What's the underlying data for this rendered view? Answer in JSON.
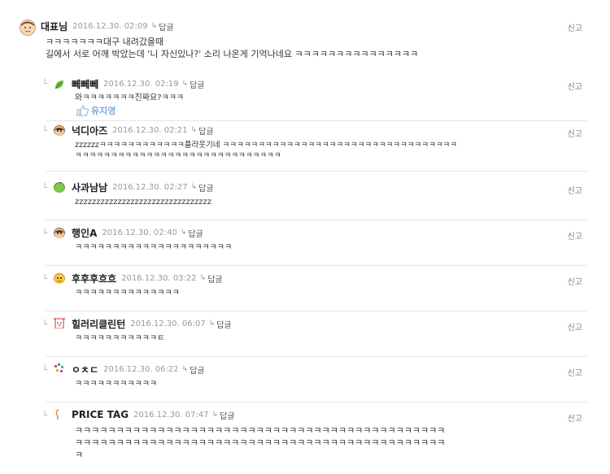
{
  "report_label": "신고",
  "reply_label": "답글",
  "comments": [
    {
      "name": "대표님",
      "date": "2016.12.30. 02:09",
      "lines": [
        "ㅋㅋㅋㅋㅋㅋㅋ대구 내려갔을때",
        "길에서 서로 어깨 박았는데 '니 자신있나?' 소리 나온게 기억나네요 ㅋㅋㅋㅋㅋㅋㅋㅋㅋㅋㅋㅋㅋㅋㅋ"
      ]
    },
    {
      "name": "뻬뻬뻬",
      "date": "2016.12.30. 02:19",
      "lines": [
        "와ㅋㅋㅋㅋㅋㅋㅋ진짜요?ㅋㅋㅋ"
      ],
      "like_name": "유지영"
    },
    {
      "name": "넉디아즈",
      "date": "2016.12.30. 02:21",
      "lines": [
        "zzzzzzㅋㅋㅋㅋㅋㅋㅋㅋㅋㅋㅋㅋ플라웃기네 ㅋㅋㅋㅋㅋㅋㅋㅋㅋㅋㅋㅋㅋㅋㅋㅋㅋㅋㅋㅋㅋㅋㅋㅋㅋㅋㅋㅋㅋㅋㅋㅋㅋ",
        "ㅋㅋㅋㅋㅋㅋㅋㅋㅋㅋㅋㅋㅋㅋㅋㅋㅋㅋㅋㅋㅋㅋㅋㅋㅋㅋㅋㅋㅋ"
      ]
    },
    {
      "name": "사과남남",
      "date": "2016.12.30. 02:27",
      "lines": [
        "zzzzzzzzzzzzzzzzzzzzzzzzzzzzzzzz"
      ]
    },
    {
      "name": "행인A",
      "date": "2016.12.30. 02:40",
      "lines": [
        "ㅋㅋㅋㅋㅋㅋㅋㅋㅋㅋㅋㅋㅋㅋㅋㅋㅋㅋㅋㅋㅋ"
      ]
    },
    {
      "name": "후후후흐흐",
      "date": "2016.12.30. 03:22",
      "lines": [
        "ㅋㅋㅋㅋㅋㅋㅋㅋㅋㅋㅋㅋㅋㅋ"
      ]
    },
    {
      "name": "힐러리클린턴",
      "date": "2016.12.30. 06:07",
      "lines": [
        "ㅋㅋㅋㅋㅋㅋㅋㅋㅋㅋㅋㅌ"
      ]
    },
    {
      "name": "ㅇㅊㄷ",
      "date": "2016.12.30. 06:22",
      "lines": [
        "ㅋㅋㅋㅋㅋㅋㅋㅋㅋㅋㅋ"
      ]
    },
    {
      "name": "PRICE TAG",
      "date": "2016.12.30. 07:47",
      "lines": [
        "ㅋㅋㅋㅋㅋㅋㅋㅋㅋㅋㅋㅋㅋㅋㅋㅋㅋㅋㅋㅋㅋㅋㅋㅋㅋㅋㅋㅋㅋㅋㅋㅋㅋㅋㅋㅋㅋㅋㅋㅋㅋㅋㅋㅋㅋ",
        "ㅋㅋㅋㅋㅋㅋㅋㅋㅋㅋㅋㅋㅋㅋㅋㅋㅋㅋㅋㅋㅋㅋㅋㅋㅋㅋㅋㅋㅋㅋㅋㅋㅋㅋㅋㅋㅋㅋㅋㅋㅋㅋㅋㅋㅋ",
        "ㅋ"
      ]
    }
  ]
}
